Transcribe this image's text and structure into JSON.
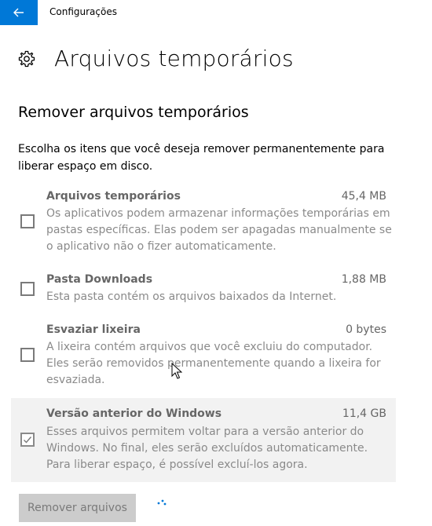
{
  "window": {
    "title": "Configurações"
  },
  "page": {
    "title": "Arquivos temporários"
  },
  "section": {
    "title": "Remover arquivos temporários",
    "description": "Escolha os itens que você deseja remover permanentemente para liberar espaço em disco."
  },
  "items": [
    {
      "name": "Arquivos temporários",
      "size": "45,4 MB",
      "description": "Os aplicativos podem armazenar informações temporárias em pastas específicas. Elas podem ser apagadas manualmente se o aplicativo não o fizer automaticamente.",
      "checked": false
    },
    {
      "name": "Pasta Downloads",
      "size": "1,88 MB",
      "description": "Esta pasta contém os arquivos baixados da Internet.",
      "checked": false
    },
    {
      "name": "Esvaziar lixeira",
      "size": "0 bytes",
      "description": "A lixeira contém arquivos que você excluiu do computador. Eles serão removidos permanentemente quando a lixeira for esvaziada.",
      "checked": false
    },
    {
      "name": "Versão anterior do Windows",
      "size": "11,4 GB",
      "description": "Esses arquivos permitem voltar para a versão anterior do Windows. No final, eles serão excluídos automaticamente. Para liberar espaço, é possível excluí-los agora.",
      "checked": true
    }
  ],
  "actions": {
    "remove_label": "Remover arquivos"
  },
  "icons": {
    "back": "back-arrow-icon",
    "settings": "gear-icon",
    "progress": "loading-dots-icon"
  },
  "colors": {
    "accent": "#0078d7",
    "disabled_button": "#cccccc"
  }
}
